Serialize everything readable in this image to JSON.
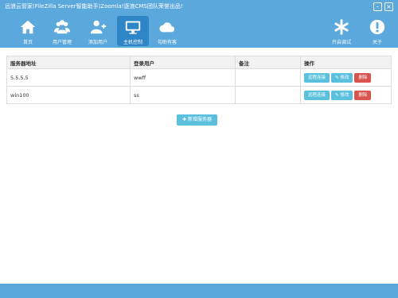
{
  "window": {
    "title": "远浪云管家(FileZilla Server智能助手)Zoomla!逐浪CMS团队荣誉出品!"
  },
  "toolbar": {
    "home": "首页",
    "users": "用户管理",
    "add_user": "添加用户",
    "host_control": "主机控制",
    "cloud": "勾助有客",
    "start_debug": "开启调试",
    "about": "关于"
  },
  "table": {
    "headers": [
      "服务器地址",
      "登录用户",
      "备注",
      "操作"
    ],
    "rows": [
      {
        "address": "5.5.5.5",
        "user": "wwff",
        "note": ""
      },
      {
        "address": "win100",
        "user": "ss",
        "note": ""
      }
    ],
    "actions": {
      "remote": "远程连接",
      "edit": "修改",
      "delete": "删除"
    }
  },
  "add_server": "新增服务器",
  "colors": {
    "accent": "#5aa8dc",
    "active": "#2f86c6",
    "info": "#5bc0de",
    "danger": "#d9534f"
  }
}
